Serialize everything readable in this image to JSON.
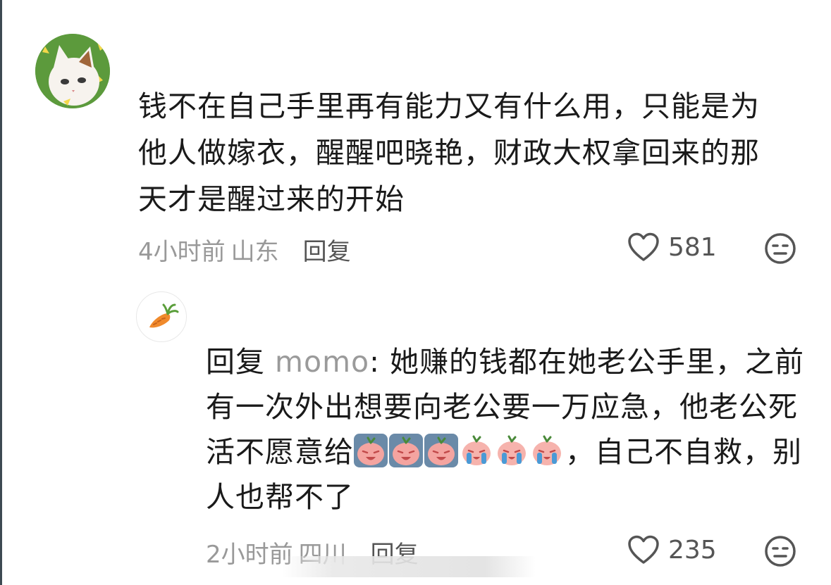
{
  "comment": {
    "text": "钱不在自己手里再有能力又有什么用，只能是为他人做嫁衣，醒醒吧晓艳，财政大权拿回来的那天才是醒过来的开始",
    "time": "4小时前",
    "location": "山东",
    "reply_label": "回复",
    "likes": "581"
  },
  "reply": {
    "prefix": "回复",
    "reply_to": "momo",
    "colon": ":",
    "text_before": "她赚的钱都在她老公手里，之前有一次外出想要向老公要一万应急，他老公死活不愿意给",
    "text_after": "，自己不自救，别人也帮不了",
    "time": "2小时前",
    "location": "四川",
    "reply_label": "回复",
    "likes": "235"
  },
  "emojis": [
    "crying-peach-emoji",
    "crying-peach-emoji",
    "crying-peach-emoji",
    "sobbing-peach-emoji",
    "sobbing-peach-emoji",
    "sobbing-peach-emoji"
  ],
  "colors": {
    "text": "#1a1a1a",
    "meta": "#999999",
    "avatar_bg": "#5c9a3c"
  }
}
